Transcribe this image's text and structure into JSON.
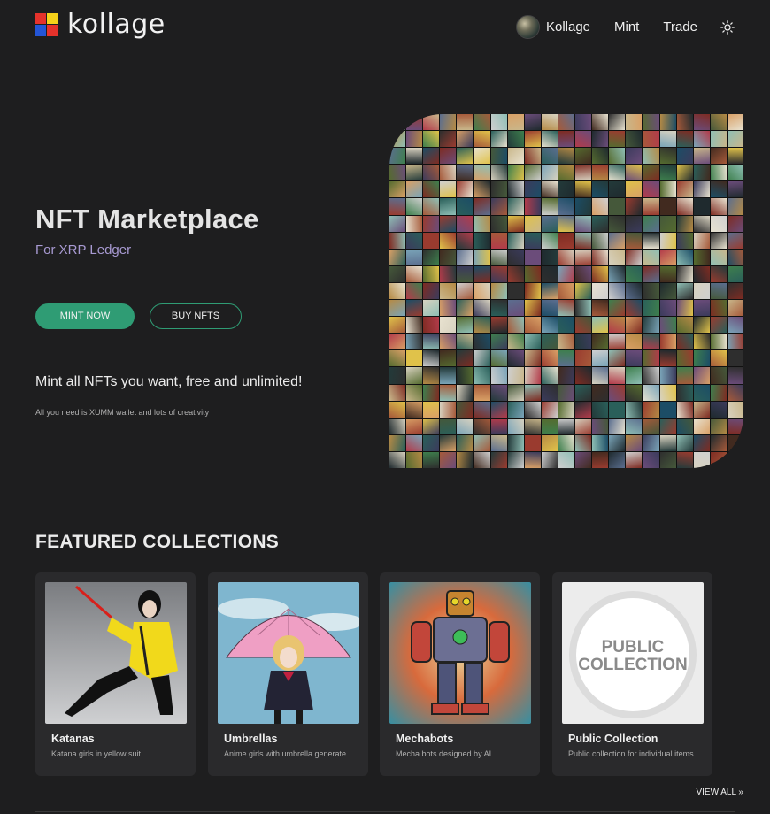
{
  "header": {
    "logo_text": "kollage",
    "nav": {
      "profile_label": "Kollage",
      "mint_label": "Mint",
      "trade_label": "Trade",
      "theme_icon": "sun-icon"
    }
  },
  "hero": {
    "title": "NFT Marketplace",
    "subtitle": "For XRP Ledger",
    "mint_button": "MINT NOW",
    "buy_button": "BUY NFTS",
    "tagline": "Mint all NFTs you want, free and unlimited!",
    "note": "All you need is XUMM wallet and lots of creativity"
  },
  "featured": {
    "title": "FEATURED COLLECTIONS",
    "view_all": "VIEW ALL »",
    "collections": [
      {
        "name": "Katanas",
        "description": "Katana girls in yellow suit"
      },
      {
        "name": "Umbrellas",
        "description": "Anime girls with umbrella generated by AI"
      },
      {
        "name": "Mechabots",
        "description": "Mecha bots designed by AI"
      },
      {
        "name": "Public Collection",
        "description": "Public collection for individual items",
        "badge_line1": "PUBLIC",
        "badge_line2": "COLLECTION"
      }
    ]
  },
  "colors": {
    "background": "#1e1e1f",
    "accent": "#2f9c74",
    "subtitle": "#a89ad2",
    "card": "#2a2a2c"
  }
}
